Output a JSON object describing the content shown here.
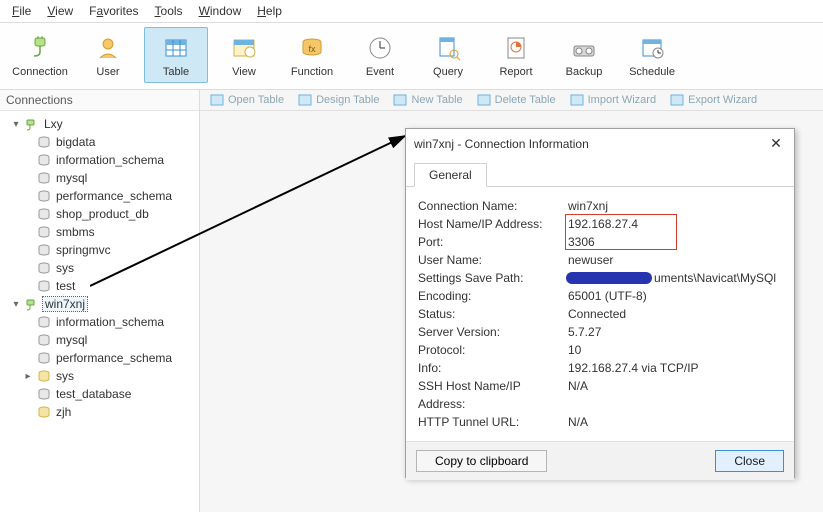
{
  "menu": {
    "items": [
      "File",
      "View",
      "Favorites",
      "Tools",
      "Window",
      "Help"
    ]
  },
  "ribbon": {
    "items": [
      {
        "label": "Connection",
        "icon": "plug"
      },
      {
        "label": "User",
        "icon": "user"
      },
      {
        "label": "Table",
        "icon": "table",
        "active": true
      },
      {
        "label": "View",
        "icon": "view"
      },
      {
        "label": "Function",
        "icon": "fx"
      },
      {
        "label": "Event",
        "icon": "clock"
      },
      {
        "label": "Query",
        "icon": "query"
      },
      {
        "label": "Report",
        "icon": "report"
      },
      {
        "label": "Backup",
        "icon": "backup"
      },
      {
        "label": "Schedule",
        "icon": "schedule"
      }
    ]
  },
  "sidebar_header": "Connections",
  "tree": {
    "conn1": {
      "label": "Lxy",
      "children": [
        "bigdata",
        "information_schema",
        "mysql",
        "performance_schema",
        "shop_product_db",
        "smbms",
        "springmvc",
        "sys",
        "test"
      ]
    },
    "conn2": {
      "label": "win7xnj",
      "children": [
        "information_schema",
        "mysql",
        "performance_schema",
        "sys",
        "test_database",
        "zjh"
      ]
    }
  },
  "subtoolbar": [
    "Open Table",
    "Design Table",
    "New Table",
    "Delete Table",
    "Import Wizard",
    "Export Wizard"
  ],
  "dialog": {
    "title": "win7xnj - Connection Information",
    "tab": "General",
    "fields": {
      "conn_name_label": "Connection Name:",
      "conn_name": "win7xnj",
      "host_label": "Host Name/IP Address:",
      "host": "192.168.27.4",
      "port_label": "Port:",
      "port": "3306",
      "user_label": "User Name:",
      "user": "newuser",
      "path_label": "Settings Save Path:",
      "path_suffix": "uments\\Navicat\\MySQl",
      "enc_label": "Encoding:",
      "enc": "65001 (UTF-8)",
      "status_label": "Status:",
      "status": "Connected",
      "sv_label": "Server Version:",
      "sv": "5.7.27",
      "proto_label": "Protocol:",
      "proto": "10",
      "info_label": "Info:",
      "info": "192.168.27.4 via TCP/IP",
      "ssh_label": "SSH Host Name/IP Address:",
      "ssh": "N/A",
      "http_label": "HTTP Tunnel URL:",
      "http": "N/A"
    },
    "copy_btn": "Copy to clipboard",
    "close_btn": "Close"
  }
}
